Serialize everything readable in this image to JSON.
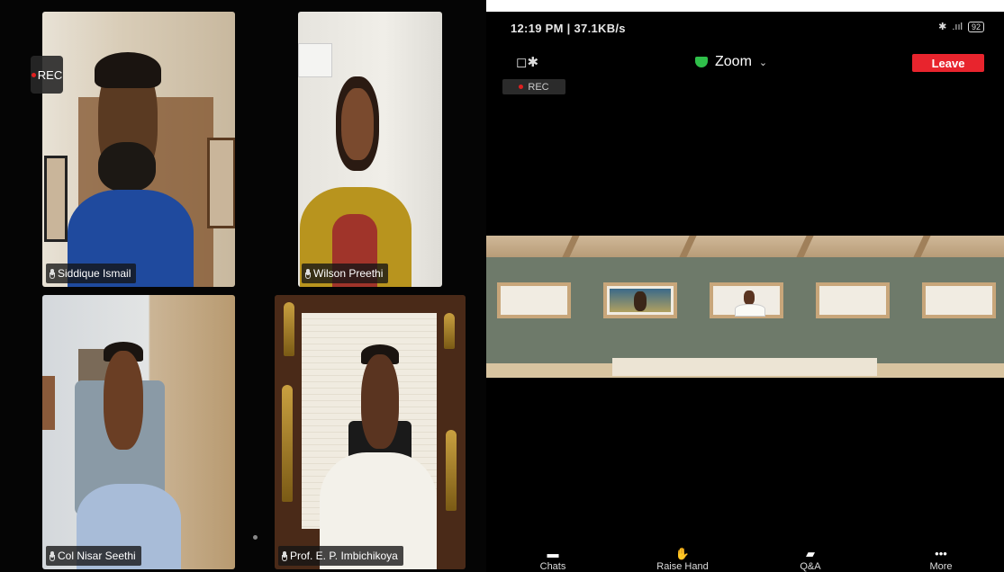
{
  "desktop": {
    "rec_label": "REC",
    "participants": [
      {
        "name": "Siddique Ismail"
      },
      {
        "name": "Wilson Preethi"
      },
      {
        "name": "Col Nisar Seethi"
      },
      {
        "name": "Prof. E. P. Imbichikoya"
      }
    ]
  },
  "phone": {
    "status": {
      "time": "12:19 PM | 37.1KB/s",
      "battery": "92"
    },
    "title": "Zoom",
    "leave_label": "Leave",
    "rec_label": "REC",
    "toolbar": [
      {
        "label": "Chats",
        "icon": "chat-icon"
      },
      {
        "label": "Raise Hand",
        "icon": "hand-icon"
      },
      {
        "label": "Q&A",
        "icon": "qa-icon"
      },
      {
        "label": "More",
        "icon": "more-icon"
      }
    ]
  },
  "colors": {
    "leave": "#e8242d",
    "shield": "#2fbf4a",
    "rec_dot": "#e02020"
  }
}
